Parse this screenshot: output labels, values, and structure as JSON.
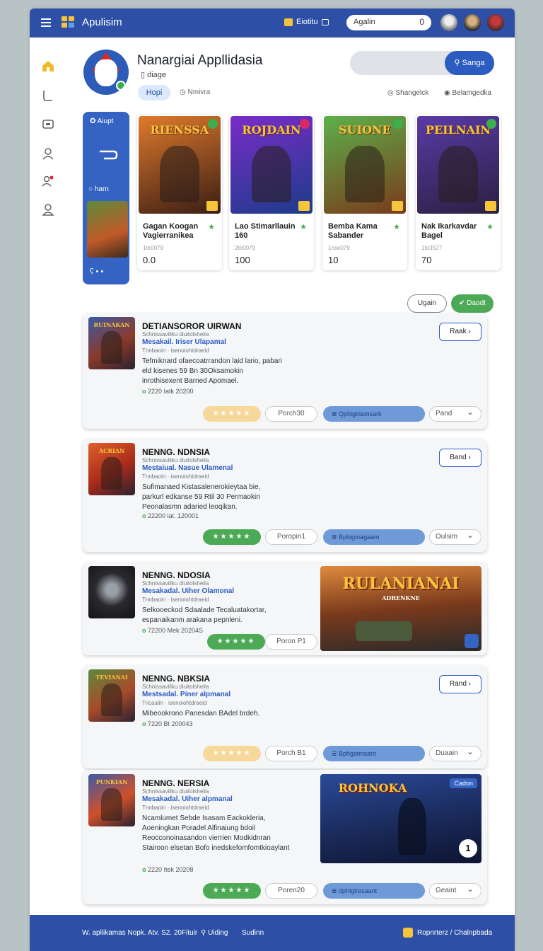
{
  "topbar": {
    "app_name": "Apulisim",
    "chip_label": "Eiotitu",
    "search_placeholder": "Agalin",
    "search_count": "0"
  },
  "header": {
    "title": "Nanargiai Appllidasia",
    "subtitle": "diage",
    "tab_active": "Hopi",
    "meta_left": "Nmivra",
    "search_button": "Sanga",
    "meta_right_1": "Shangelck",
    "meta_right_2": "Belamgedka"
  },
  "featured": {
    "side_card": {
      "top_label": "Aiupt",
      "mid_label": "harn"
    },
    "cards": [
      {
        "art_title": "RIENSSA",
        "name": "Gagan Koogan Vagierranikea",
        "sub": "1te0079",
        "value": "0.0",
        "art_from": "#e07a2c",
        "art_to": "#3a1d14",
        "badge": "#3eae4c"
      },
      {
        "art_title": "ROJDAIN",
        "name": "Lao Stimarllauin 160",
        "sub": "2to0079",
        "value": "100",
        "art_from": "#7a2cc8",
        "art_to": "#1c3c8a",
        "badge": "#d8286a"
      },
      {
        "art_title": "SUIONE",
        "name": "Bemba Kama Sabander",
        "sub": "1nse079",
        "value": "10",
        "art_from": "#5cb04a",
        "art_to": "#7a3a1c",
        "badge": "#3eae4c"
      },
      {
        "art_title": "PEILNAIN",
        "name": "Nak Ikarkavdar Bagel",
        "sub": "1to3527",
        "value": "70",
        "art_from": "#5a3aa8",
        "art_to": "#2a2040",
        "badge": "#3eae4c"
      }
    ],
    "btn_left": "Ugain",
    "btn_right": "Daodt"
  },
  "items": [
    {
      "thumb_title": "RUINAKAN",
      "title": "DETIANSOROR UIRWAN",
      "small1": "Schnissaviliku diuitolsheila",
      "blue": "Mesakail. Iriser Ulapamal",
      "small2": "Tnnbaoin · isenoiohtdraeid",
      "desc": "Tefmiknard ofaecoatrrandon laid lario, pabari eld kisenes 59 Bn 30Oksamokin inrothisexent Barned Apomael.",
      "date": "2220 Iatk 20200",
      "stars": "★★★★★",
      "porch": "Porch30",
      "bluebar": "Qphigirlamsark",
      "action": "Raak",
      "drop": "Pand"
    },
    {
      "thumb_title": "ACRIAN",
      "title": "NENNG. NDNSIA",
      "small1": "Schnissaviliku diuitolsheila",
      "blue": "Mestaiual. Nasue Ulamenal",
      "small2": "Tnnbaoin · isenoiohtdraeid",
      "desc": "Sufimanaed Kistasalenerokieytaa bie, parkurl edkanse 59 Rtil 30 Permaokin Peonalasmn adaried leoqikan.",
      "date": "22200 lat. 120001",
      "stars": "★★★★★",
      "porch": "Poropin1",
      "bluebar": "Bphiginagaam",
      "action": "Band",
      "drop": "Oulsim"
    },
    {
      "thumb_title": "",
      "title": "NENNG. NDOSIA",
      "small1": "Schnissaviliku diuitolsheila",
      "blue": "Mesakadal. Uiher Olamonal",
      "small2": "Tnnbaoin · isenoiohtdraeid",
      "desc": "Selkooeckod Sdaalade Tecaluatakortar, espanaikanm arakana pepnleni.",
      "date": "72200 Mek 20204S",
      "stars": "★★★★★",
      "porch": "Poron P1",
      "art_title": "RULANIANAI",
      "art_sub": "ADRENKNE"
    },
    {
      "thumb_title": "TEVIANAI",
      "title": "NENNG. NBKSIA",
      "small1": "Schnissaviliku diuitolsheila",
      "blue": "Mestsadal. Piner alpmanal",
      "small2": "Tricaalin · isenoiohtdraeid",
      "desc": "Mibeookrono Panesdan BAdel brdeh.",
      "date": "7220 Bt 200043",
      "stars": "★★★★★",
      "porch": "Porch B1",
      "bluebar": "Bphgiamsant",
      "action": "Rand",
      "drop": "Duaain"
    },
    {
      "thumb_title": "PUNKIAN",
      "title": "NENNG. NERSIA",
      "small1": "Schnissaviliku diuitolsheila",
      "blue": "Mesakadal. Uiher alpmanal",
      "small2": "Tnnbaoin · isenoiohtdraeid",
      "desc": "Ncamlumet Sebde Isasam Eackokleria, Aoeningkan Poradel Alfinaiung bdoil Reocconoinasandon vierrien Modkidnran Stairoon elsetan Bofo inedskefomfomtkioaylant",
      "date": "2220 Itek 20208",
      "stars": "★★★★★",
      "porch": "Poren20",
      "bluebar": "dphigiresaant",
      "drop": "Geaint",
      "art_title": "ROHNOKA",
      "art_chip": "Cadon",
      "art_badge": "1"
    }
  ],
  "footer": {
    "left": "W. apliikamas Nopk. Atv. S2. 20Fituir",
    "mid1": "Uiding",
    "mid2": "Sudinn",
    "right": "Ropnrterz / Chalnpbada"
  }
}
